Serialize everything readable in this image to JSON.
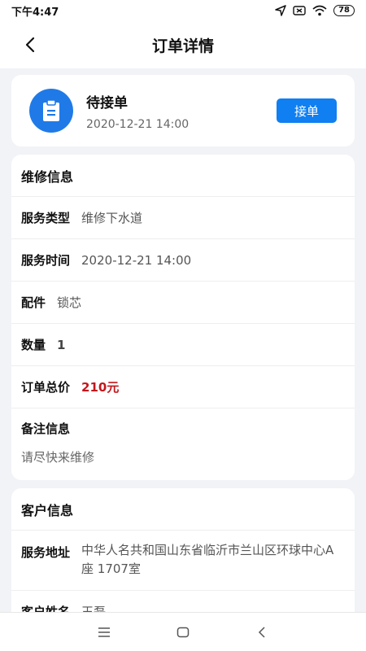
{
  "status_bar": {
    "time": "下午4:47",
    "battery": "78"
  },
  "header": {
    "title": "订单详情"
  },
  "order_status": {
    "title": "待接单",
    "date": "2020-12-21    14:00",
    "accept_label": "接单"
  },
  "repair_info": {
    "section_title": "维修信息",
    "rows": [
      {
        "label": "服务类型",
        "value": "维修下水道"
      },
      {
        "label": "服务时间",
        "value": "2020-12-21    14:00"
      },
      {
        "label": "配件",
        "value": "锁芯"
      },
      {
        "label": "数量",
        "value": "1"
      },
      {
        "label": "订单总价",
        "value": "210元"
      }
    ],
    "note_label": "备注信息",
    "note_text": "请尽快来维修"
  },
  "customer_info": {
    "section_title": "客户信息",
    "address_label": "服务地址",
    "address_value": "中华人名共和国山东省临沂市兰山区环球中心A座   1707室",
    "next_row_label": "客户姓名",
    "next_row_value": "王磊"
  },
  "colors": {
    "accent": "#0f7ff1",
    "price": "#c4161c",
    "icon_bg": "#1f7ae8"
  },
  "icons": [
    "back-arrow-icon",
    "clipboard-icon",
    "location-icon",
    "sim-icon",
    "wifi-icon",
    "menu-icon",
    "home-icon",
    "back-icon"
  ]
}
